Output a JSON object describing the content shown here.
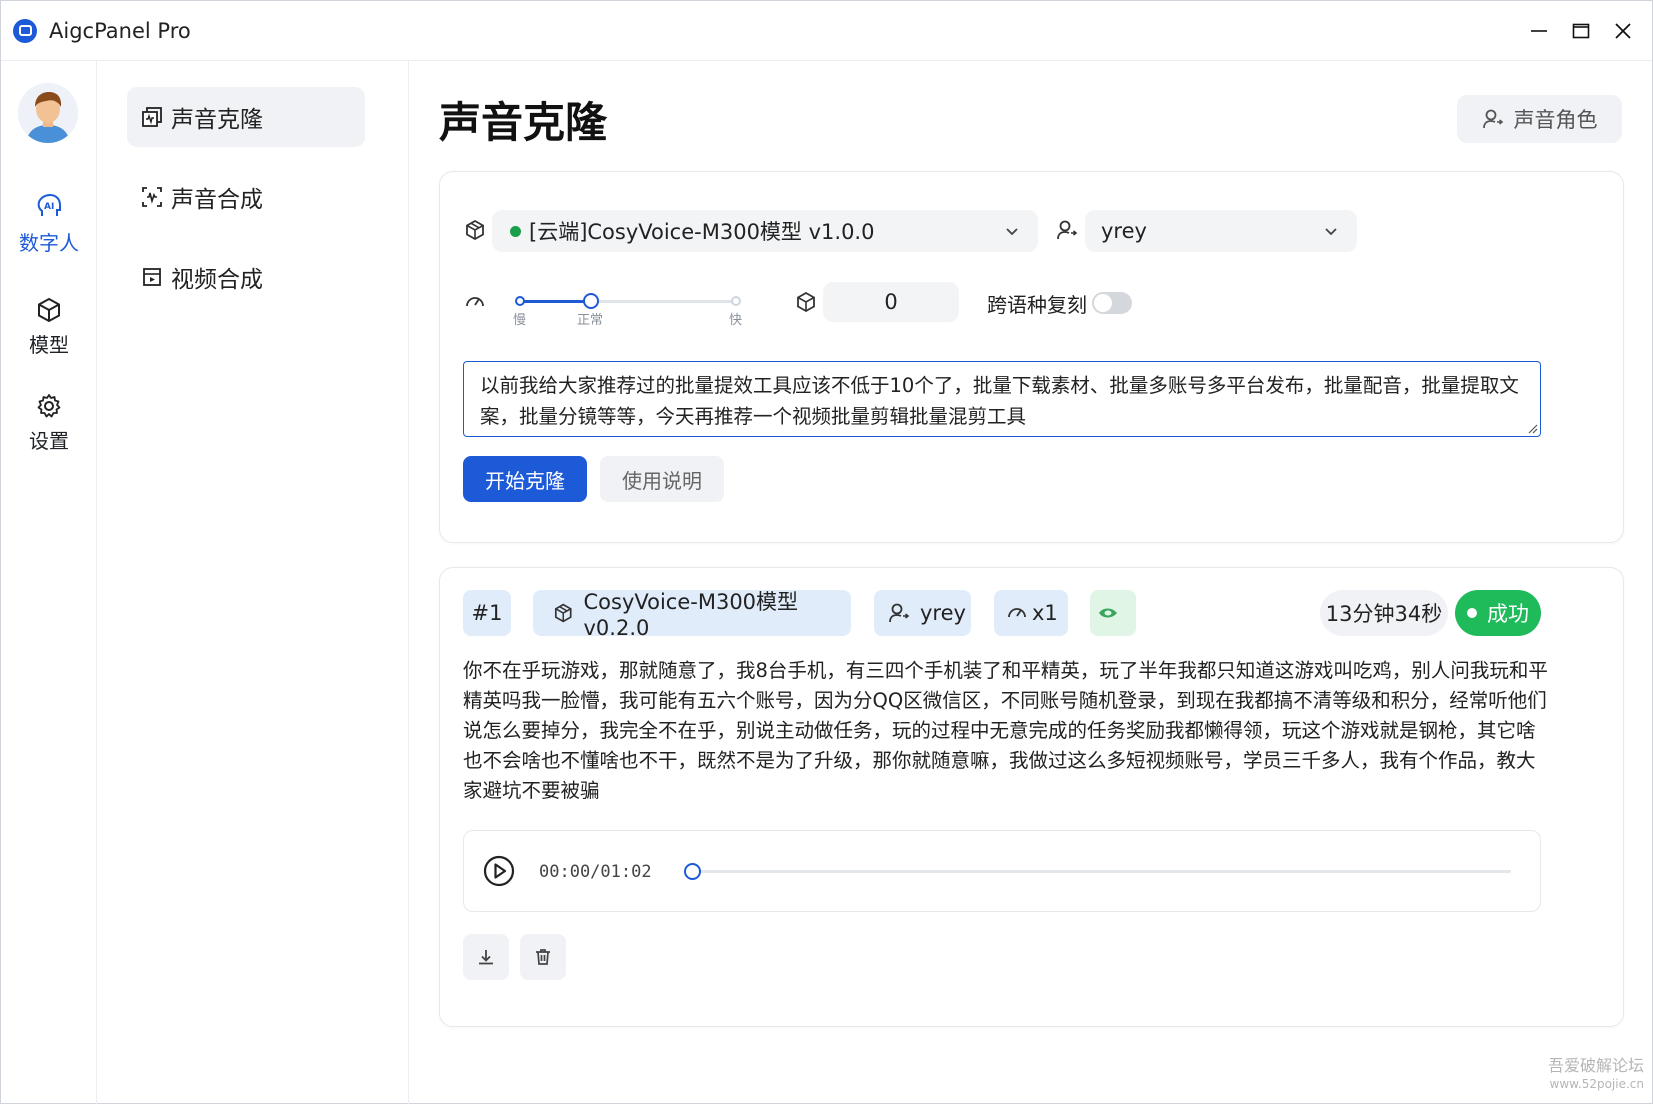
{
  "app": {
    "title": "AigcPanel Pro"
  },
  "rail": {
    "items": [
      {
        "label": "数字人",
        "icon": "ai-head-icon"
      },
      {
        "label": "模型",
        "icon": "cube-icon"
      },
      {
        "label": "设置",
        "icon": "gear-icon"
      }
    ]
  },
  "subnav": {
    "items": [
      {
        "label": "声音克隆",
        "icon": "voice-clone-icon"
      },
      {
        "label": "声音合成",
        "icon": "voice-synth-icon"
      },
      {
        "label": "视频合成",
        "icon": "video-icon"
      }
    ]
  },
  "page": {
    "title": "声音克隆",
    "role_button": "声音角色"
  },
  "form": {
    "model_select": "[云端]CosyVoice-M300模型 v1.0.0",
    "model_status_color": "#1a9e4b",
    "speaker_select": "yrey",
    "speed": {
      "labels": [
        "慢",
        "正常",
        "快"
      ],
      "value_label": "正常"
    },
    "seed_value": "0",
    "cross_lang_label": "跨语种复刻",
    "cross_lang_on": false,
    "text": "以前我给大家推荐过的批量提效工具应该不低于10个了，批量下载素材、批量多账号多平台发布，批量配音，批量提取文案，批量分镜等等，今天再推荐一个视频批量剪辑批量混剪工具",
    "start_button": "开始克隆",
    "help_button": "使用说明"
  },
  "result": {
    "index": "#1",
    "model": "CosyVoice-M300模型 v0.2.0",
    "speaker": "yrey",
    "speed": "x1",
    "duration": "13分钟34秒",
    "status": "成功",
    "status_color": "#1fba5a",
    "text": "你不在乎玩游戏，那就随意了，我8台手机，有三四个手机装了和平精英，玩了半年我都只知道这游戏叫吃鸡，别人问我玩和平精英吗我一脸懵，我可能有五六个账号，因为分QQ区微信区，不同账号随机登录，到现在我都搞不清等级和积分，经常听他们说怎么要掉分，我完全不在乎，别说主动做任务，玩的过程中无意完成的任务奖励我都懒得领，玩这个游戏就是钢枪，其它啥也不会啥也不懂啥也不干，既然不是为了升级，那你就随意嘛，我做过这么多短视频账号，学员三千多人，我有个作品，教大家避坑不要被骗",
    "player_time": "00:00/01:02",
    "progress": 0
  },
  "accent_color": "#1d5ad8",
  "watermark": {
    "line1": "吾爱破解论坛",
    "line2": "www.52pojie.cn"
  }
}
